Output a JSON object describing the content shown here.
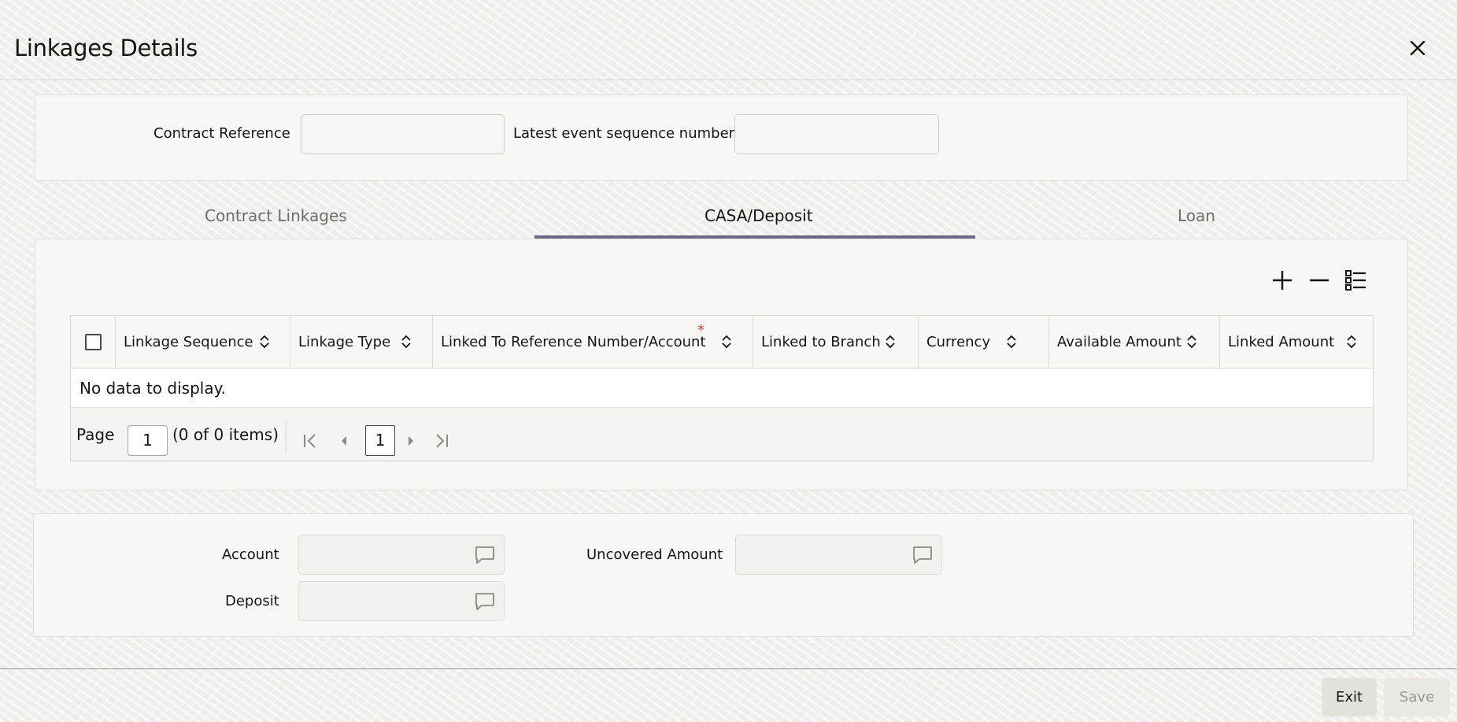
{
  "window": {
    "title": "Linkages Details",
    "close_icon": "close-icon"
  },
  "header_form": {
    "contract_reference_label": "Contract Reference",
    "contract_reference_value": "",
    "latest_event_label": "Latest event sequence number",
    "latest_event_value": ""
  },
  "tabs": [
    {
      "label": "Contract Linkages",
      "active": false
    },
    {
      "label": "CASA/Deposit",
      "active": true
    },
    {
      "label": "Loan",
      "active": false
    }
  ],
  "toolbar": {
    "add_icon": "plus-icon",
    "remove_icon": "minus-icon",
    "details_icon": "list-details-icon"
  },
  "grid": {
    "columns": [
      {
        "label": "Linkage Sequence",
        "required": false
      },
      {
        "label": "Linkage Type",
        "required": false
      },
      {
        "label": "Linked To Reference Number/Account",
        "required": true
      },
      {
        "label": "Linked to Branch",
        "required": false
      },
      {
        "label": "Currency",
        "required": false
      },
      {
        "label": "Available Amount",
        "required": false
      },
      {
        "label": "Linked Amount",
        "required": false
      }
    ],
    "required_marker": "*",
    "empty_text": "No data to display.",
    "pager": {
      "page_label": "Page",
      "page_value": "1",
      "items_text": "(0 of 0 items)",
      "current_page": "1"
    }
  },
  "bottom_form": {
    "account_label": "Account",
    "account_value": "",
    "uncovered_amount_label": "Uncovered Amount",
    "uncovered_amount_value": "",
    "deposit_label": "Deposit",
    "deposit_value": ""
  },
  "footer": {
    "exit_label": "Exit",
    "save_label": "Save"
  },
  "colors": {
    "tab_underline": "#6c6a82",
    "required_star": "#c74634"
  }
}
